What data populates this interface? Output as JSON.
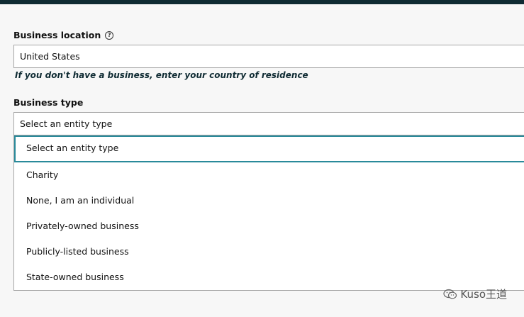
{
  "business_location": {
    "label": "Business location",
    "value": "United States",
    "hint": "If you don't have a business, enter your country of residence"
  },
  "business_type": {
    "label": "Business type",
    "value": "Select an entity type",
    "options": [
      "Select an entity type",
      "Charity",
      "None, I am an individual",
      "Privately-owned business",
      "Publicly-listed business",
      "State-owned business"
    ],
    "highlighted_index": 0
  },
  "watermark": {
    "text": "Kuso王道"
  },
  "colors": {
    "topbar": "#0f2b33",
    "focus": "#2a8a9a"
  }
}
